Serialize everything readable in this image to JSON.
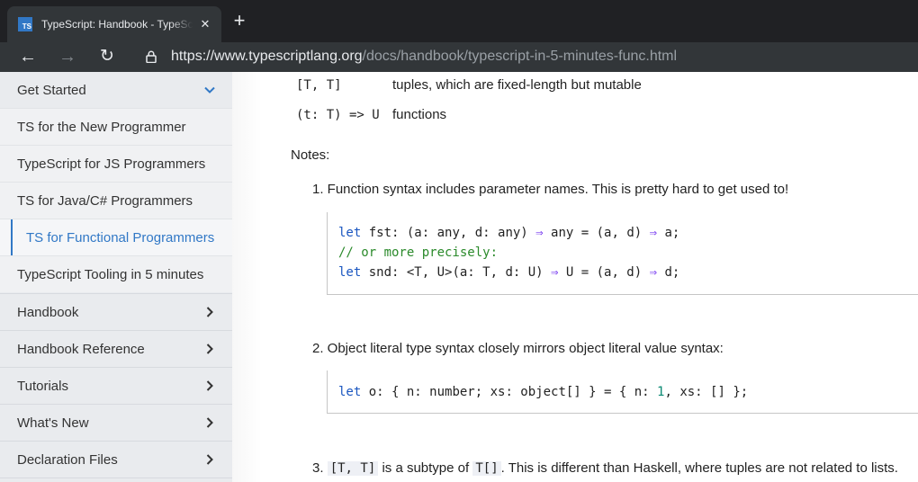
{
  "browser": {
    "tab_title": "TypeScript: Handbook - TypeScript",
    "favicon_text": "TS",
    "url_host": "https://www.typescriptlang.org",
    "url_path": "/docs/handbook/typescript-in-5-minutes-func.html"
  },
  "sidebar": {
    "get_started": "Get Started",
    "sub_items": [
      "TS for the New Programmer",
      "TypeScript for JS Programmers",
      "TS for Java/C# Programmers",
      "TS for Functional Programmers",
      "TypeScript Tooling in 5 minutes"
    ],
    "sections": [
      "Handbook",
      "Handbook Reference",
      "Tutorials",
      "What's New",
      "Declaration Files"
    ]
  },
  "content": {
    "table_rows": [
      {
        "code": "[T, T]",
        "desc": "tuples, which are fixed-length but mutable"
      },
      {
        "code": "(t: T) => U",
        "desc": "functions"
      }
    ],
    "notes_heading": "Notes:",
    "item1": "1. Function syntax includes parameter names. This is pretty hard to get used to!",
    "code1": {
      "line1": "let fst: (a: any, d: any) ⇒ any = (a, d) ⇒ a;",
      "line2": "// or more precisely:",
      "line3": "let snd: <T, U>(a: T, d: U) ⇒ U = (a, d) ⇒ d;"
    },
    "item2": "2. Object literal type syntax closely mirrors object literal value syntax:",
    "code2": "let o: { n: number; xs: object[] } = { n: 1, xs: [] };",
    "item3": {
      "num": "3.",
      "code_a": "[T, T]",
      "text_a": "is a subtype of",
      "code_b": "T[]",
      "text_b": ". This is different than Haskell, where tuples are not related to lists."
    }
  },
  "colors": {
    "accent": "#3178c6",
    "keyword": "#1a56c0",
    "comment": "#2b8a2b",
    "arrow": "#7a3ef0",
    "number": "#0b8a73"
  }
}
